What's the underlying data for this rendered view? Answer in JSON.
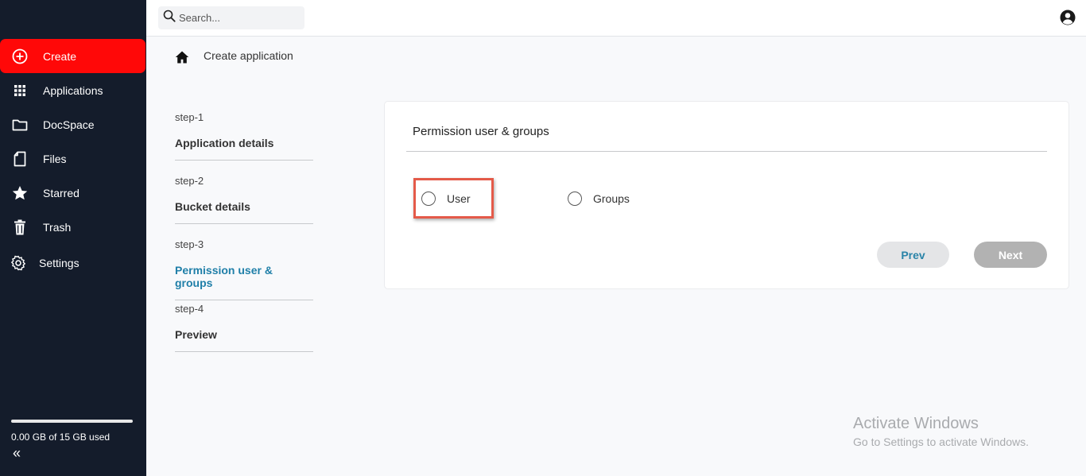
{
  "sidebar": {
    "items": [
      {
        "label": "Create",
        "icon": "plus-circle-icon"
      },
      {
        "label": "Applications",
        "icon": "grid-icon"
      },
      {
        "label": "DocSpace",
        "icon": "folder-icon"
      },
      {
        "label": "Files",
        "icon": "file-icon"
      },
      {
        "label": "Starred",
        "icon": "star-icon"
      },
      {
        "label": "Trash",
        "icon": "trash-icon"
      },
      {
        "label": "Settings",
        "icon": "gear-icon"
      }
    ],
    "storage_text": "0.00 GB of 15 GB used",
    "storage_used_fraction": 0,
    "collapse_glyph": "«"
  },
  "topbar": {
    "search_placeholder": "Search..."
  },
  "breadcrumb": {
    "title": "Create application"
  },
  "steps": [
    {
      "num": "step-1",
      "label": "Application details",
      "active": false
    },
    {
      "num": "step-2",
      "label": "Bucket details",
      "active": false
    },
    {
      "num": "step-3",
      "label": "Permission user & groups",
      "active": true
    },
    {
      "num": "step-4",
      "label": "Preview",
      "active": false
    }
  ],
  "card": {
    "title": "Permission user & groups",
    "options": [
      {
        "label": "User",
        "selected": false
      },
      {
        "label": "Groups",
        "selected": false
      }
    ],
    "prev_label": "Prev",
    "next_label": "Next"
  },
  "watermark": {
    "line1": "Activate Windows",
    "line2": "Go to Settings to activate Windows."
  },
  "colors": {
    "sidebar_bg": "#141c2b",
    "create_bg": "#ff0808",
    "active_step": "#1f7fa8",
    "highlight": "#e45a49"
  }
}
